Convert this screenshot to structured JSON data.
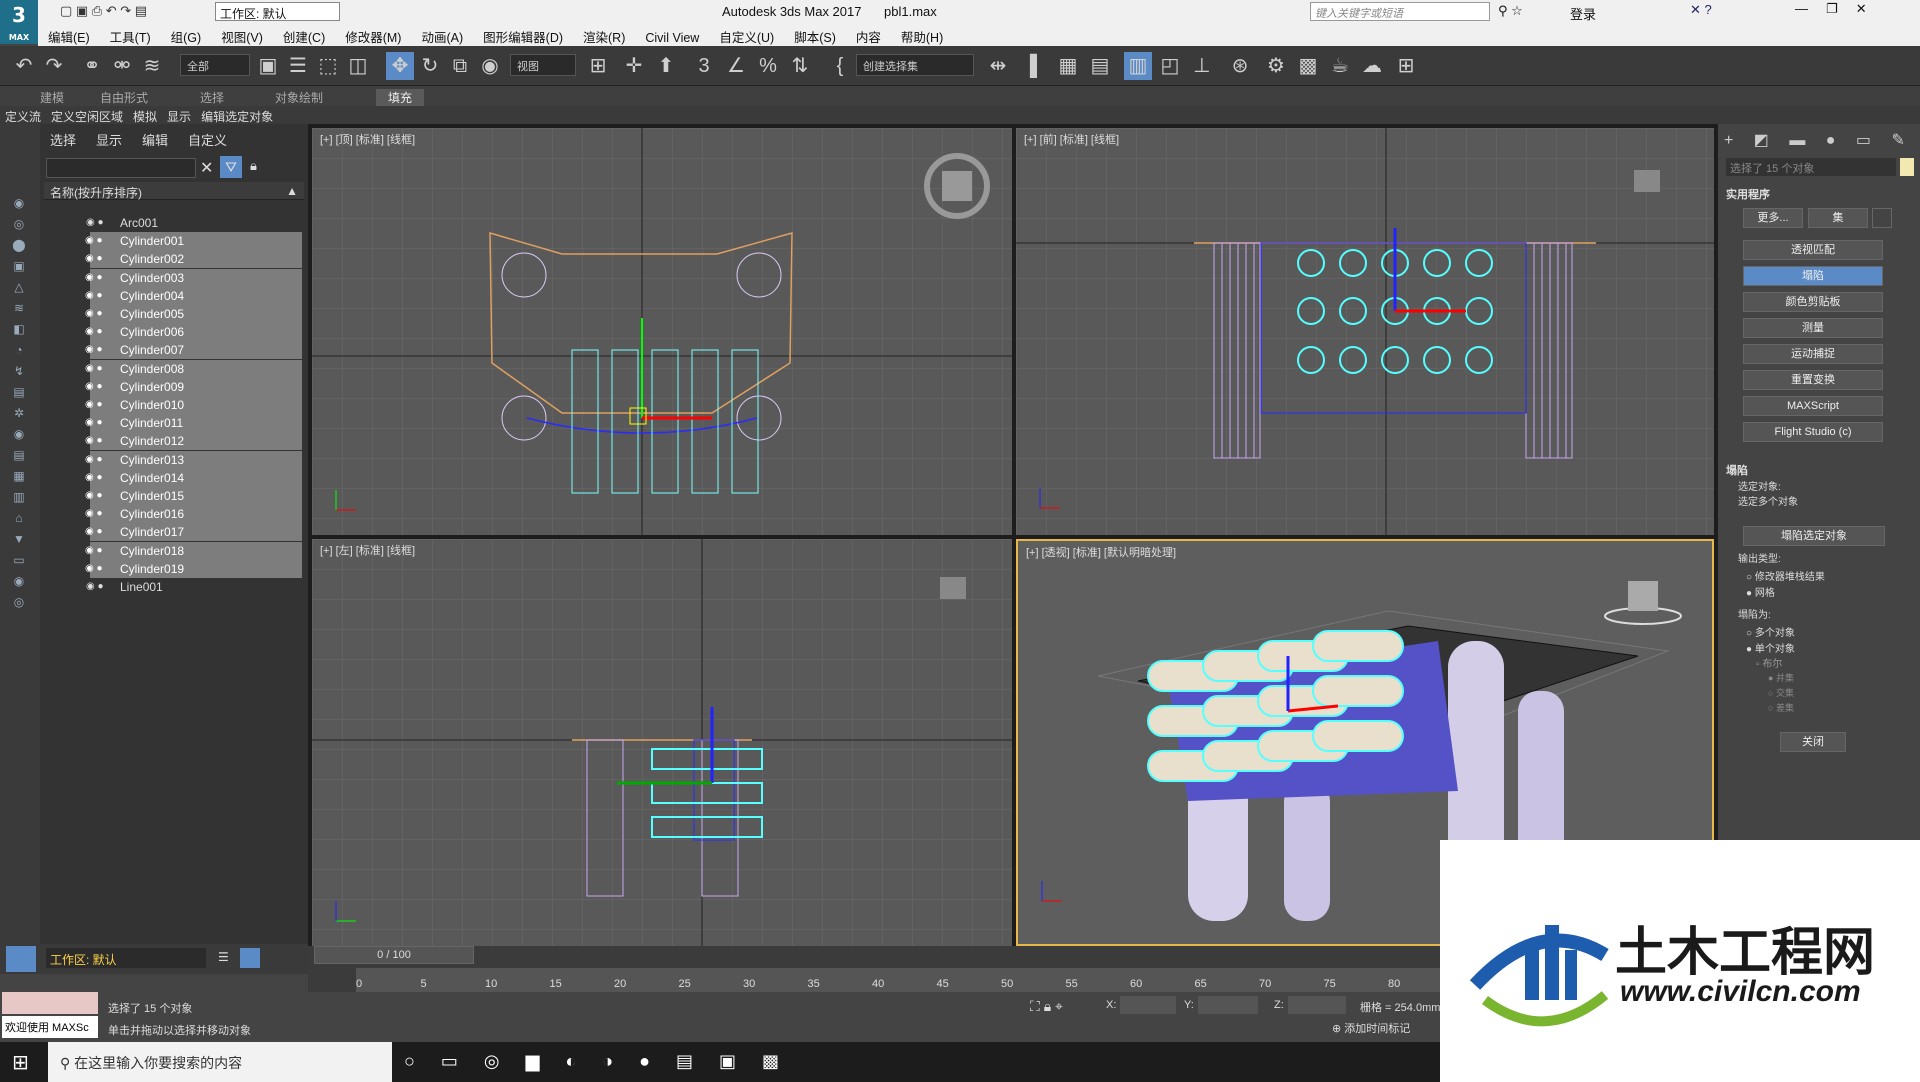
{
  "window": {
    "app_title": "Autodesk 3ds Max 2017",
    "file": "pbl1.max",
    "workspace": "工作区: 默认",
    "search_placeholder": "键入关键字或短语",
    "login": "登录"
  },
  "menu": [
    "编辑(E)",
    "工具(T)",
    "组(G)",
    "视图(V)",
    "创建(C)",
    "修改器(M)",
    "动画(A)",
    "图形编辑器(D)",
    "渲染(R)",
    "Civil View",
    "自定义(U)",
    "脚本(S)",
    "内容",
    "帮助(H)"
  ],
  "toolbar": {
    "filter": "全部",
    "view": "视图",
    "selset": "创建选择集"
  },
  "ribbon": {
    "tabs": [
      "建模",
      "自由形式",
      "选择",
      "对象绘制",
      "填充"
    ],
    "sub": [
      "定义流",
      "定义空闲区域",
      "模拟",
      "显示",
      "编辑选定对象"
    ]
  },
  "explorer": {
    "tabs": [
      "选择",
      "显示",
      "编辑",
      "自定义"
    ],
    "column": "名称(按升序排序)",
    "items": [
      "Arc001",
      "Cylinder001",
      "Cylinder002",
      "Cylinder003",
      "Cylinder004",
      "Cylinder005",
      "Cylinder006",
      "Cylinder007",
      "Cylinder008",
      "Cylinder009",
      "Cylinder010",
      "Cylinder011",
      "Cylinder012",
      "Cylinder013",
      "Cylinder014",
      "Cylinder015",
      "Cylinder016",
      "Cylinder017",
      "Cylinder018",
      "Cylinder019",
      "Line001"
    ],
    "workspace": "工作区: 默认"
  },
  "viewports": {
    "top": "[+] [顶] [标准] [线框]",
    "front": "[+] [前] [标准] [线框]",
    "left": "[+] [左] [标准] [线框]",
    "persp": "[+] [透视] [标准] [默认明暗处理]"
  },
  "command": {
    "selected": "选择了 15 个对象",
    "utilities_title": "实用程序",
    "more": "更多...",
    "sets": "集",
    "buttons": [
      "透视匹配",
      "塌陷",
      "颜色剪贴板",
      "测量",
      "运动捕捉",
      "重置变换",
      "MAXScript",
      "Flight Studio (c)"
    ],
    "collapse_title": "塌陷",
    "selected_obj_label": "选定对象:",
    "selected_obj_val": "选定多个对象",
    "collapse_btn": "塌陷选定对象",
    "output_type": "输出类型:",
    "out_opts": [
      "修改器堆栈结果",
      "网格"
    ],
    "collapse_as": "塌陷为:",
    "as_opts": [
      "多个对象",
      "单个对象"
    ],
    "bool": "布尔",
    "bool_opts": [
      "并集",
      "交集",
      "差集"
    ],
    "close": "关闭"
  },
  "timeline": {
    "frame": "0 / 100",
    "ticks": [
      "0",
      "5",
      "10",
      "15",
      "20",
      "25",
      "30",
      "35",
      "40",
      "45",
      "50",
      "55",
      "60",
      "65",
      "70",
      "75",
      "80"
    ]
  },
  "status": {
    "selected": "选择了 15 个对象",
    "hint": "单击并拖动以选择并移动对象",
    "welcome": "欢迎使用 MAXSc",
    "x": "X:",
    "y": "Y:",
    "z": "Z:",
    "grid": "栅格 = 254.0mm",
    "addtime": "添加时间标记"
  },
  "taskbar": {
    "search": "在这里输入你要搜索的内容"
  },
  "watermark": {
    "brand": "土木工程网",
    "url": "www.civilcn.com"
  }
}
